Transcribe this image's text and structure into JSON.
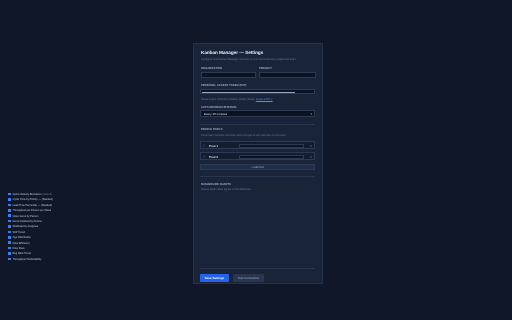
{
  "settings": {
    "title": "Kanban Manager — Settings",
    "subtitle": "Configure how Kanban Manager connects to your Azure DevOps project and team.",
    "organization_label": "Organization",
    "project_label": "Project",
    "organization_value": "",
    "project_value": "",
    "token_label": "Personal Access Token (PAT)",
    "token_hint_prefix": "Needs scopes: Work Items (Read), Identity (Read).",
    "token_hint_link": "Create a PAT ↗",
    "refresh_label": "Auto-refresh interval",
    "refresh_selected": "Every 15 minutes",
    "pools_label": "People Pools",
    "pools_hint": "Group team members into pools; each pool gets its own swim lane on the board.",
    "pools": [
      {
        "name": "Pool 1"
      },
      {
        "name": "Pool 2"
      }
    ],
    "add_pool_label": "+ Add Pool",
    "dashboard_label": "Dashboard Charts",
    "dashboard_hint": "Choose which charts appear on the dashboard.",
    "charts": [
      {
        "label": "Sprint Velocity Burndown",
        "sub": "(default)"
      },
      {
        "label": "Cycle Time by Priority — (Stacked)",
        "sub": ""
      },
      {
        "label": "Lead Time Percentile — (Stacked)",
        "sub": ""
      },
      {
        "label": "Throughput per Person per Week",
        "sub": ""
      },
      {
        "label": "Open Items by Person",
        "sub": ""
      },
      {
        "label": "Items Finished by Person",
        "sub": ""
      },
      {
        "label": "Workload by Assignee",
        "sub": ""
      },
      {
        "label": "WIP Trend",
        "sub": ""
      },
      {
        "label": "Age Distribution",
        "sub": ""
      },
      {
        "label": "Flow Efficiency",
        "sub": ""
      },
      {
        "label": "Flow Pace",
        "sub": ""
      },
      {
        "label": "Bug Rate Trend",
        "sub": ""
      },
      {
        "label": "Throughput Predictability",
        "sub": ""
      }
    ],
    "save_label": "Save Settings",
    "test_label": "Test Connection"
  },
  "colors": {
    "accent": "#2563eb",
    "checkbox": "#3b82f6",
    "panel": "#1a2438",
    "background": "#0f1729"
  },
  "token_strength": 0.82
}
